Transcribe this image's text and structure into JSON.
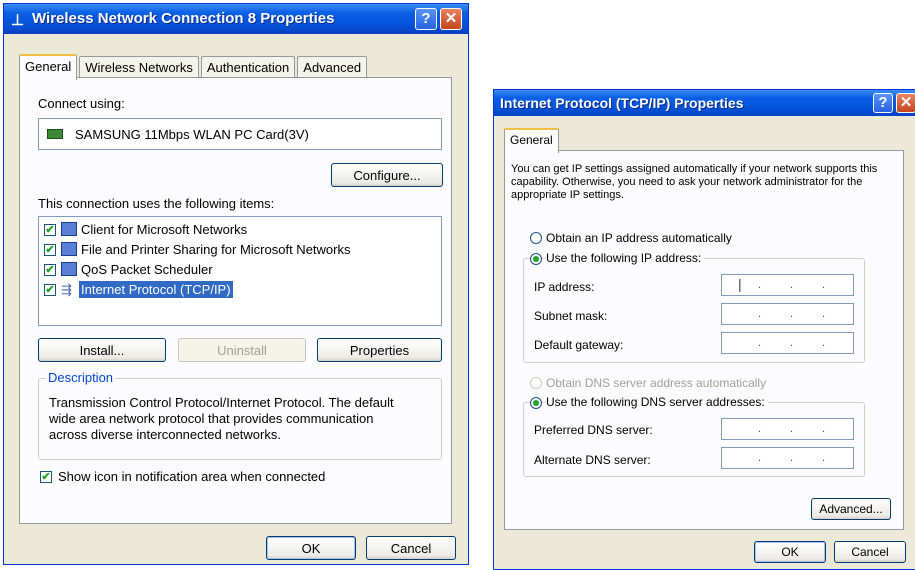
{
  "left": {
    "title": "Wireless Network Connection 8 Properties",
    "tabs": [
      "General",
      "Wireless Networks",
      "Authentication",
      "Advanced"
    ],
    "connect_using_label": "Connect using:",
    "adapter": "SAMSUNG 11Mbps WLAN PC Card(3V)",
    "configure_button": "Configure...",
    "items_label": "This connection uses the following items:",
    "items": [
      {
        "label": "Client for Microsoft Networks",
        "checked": true,
        "icon": "network-client-icon"
      },
      {
        "label": "File and Printer Sharing for Microsoft Networks",
        "checked": true,
        "icon": "printer-sharing-icon"
      },
      {
        "label": "QoS Packet Scheduler",
        "checked": true,
        "icon": "qos-scheduler-icon"
      },
      {
        "label": "Internet Protocol (TCP/IP)",
        "checked": true,
        "icon": "protocol-icon",
        "selected": true
      }
    ],
    "install_button": "Install...",
    "uninstall_button": "Uninstall",
    "properties_button": "Properties",
    "description_title": "Description",
    "description_text": "Transmission Control Protocol/Internet Protocol. The default wide area network protocol that provides communication across diverse interconnected networks.",
    "show_icon_label": "Show icon in notification area when connected",
    "ok_button": "OK",
    "cancel_button": "Cancel"
  },
  "right": {
    "title": "Internet Protocol (TCP/IP) Properties",
    "tab": "General",
    "intro": "You can get IP settings assigned automatically if your network supports this capability. Otherwise, you need to ask your network administrator for the appropriate IP settings.",
    "obtain_ip_auto": "Obtain an IP address automatically",
    "use_following_ip": "Use the following IP address:",
    "ip_address_label": "IP address:",
    "subnet_mask_label": "Subnet mask:",
    "default_gateway_label": "Default gateway:",
    "obtain_dns_auto": "Obtain DNS server address automatically",
    "use_following_dns": "Use the following DNS server addresses:",
    "preferred_dns_label": "Preferred DNS server:",
    "alternate_dns_label": "Alternate DNS server:",
    "advanced_button": "Advanced...",
    "ok_button": "OK",
    "cancel_button": "Cancel"
  },
  "colors": {
    "title_blue": "#0453d9",
    "selection": "#316ac5",
    "dialog_bg": "#ece9d8"
  }
}
